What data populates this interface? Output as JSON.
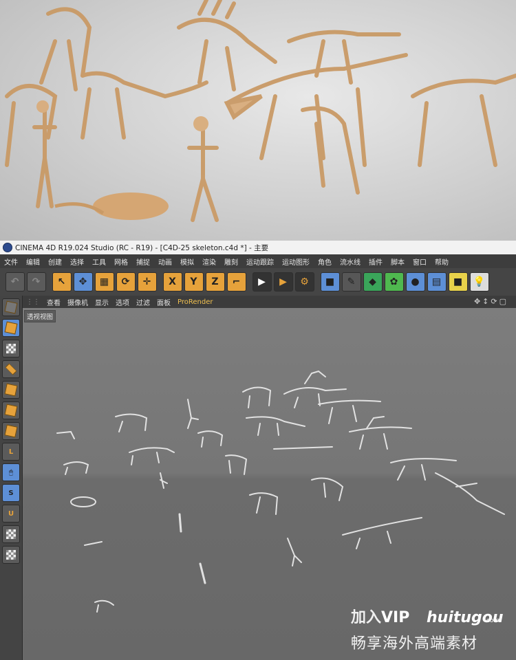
{
  "window": {
    "title": "CINEMA 4D R19.024 Studio (RC - R19) - [C4D-25 skeleton.c4d *] - 主要"
  },
  "menu": [
    "文件",
    "编辑",
    "创建",
    "选择",
    "工具",
    "网格",
    "捕捉",
    "动画",
    "模拟",
    "渲染",
    "雕刻",
    "运动跟踪",
    "运动图形",
    "角色",
    "流水线",
    "插件",
    "脚本",
    "窗口",
    "帮助"
  ],
  "toolbar": {
    "axis_x": "X",
    "axis_y": "Y",
    "axis_z": "Z"
  },
  "viewport_menu": [
    "查看",
    "摄像机",
    "显示",
    "选项",
    "过滤",
    "面板",
    "ProRender"
  ],
  "viewport_label": "透视视图",
  "watermark": {
    "line1_prefix": "加入",
    "line1_vip": "VIP",
    "logo": "huitugou",
    "logo_suffix": ".com",
    "line2": "畅享海外高端素材"
  },
  "colors": {
    "bone": "#d9ad7c",
    "accent_orange": "#e6a23b",
    "accent_blue": "#5d8fd6"
  }
}
